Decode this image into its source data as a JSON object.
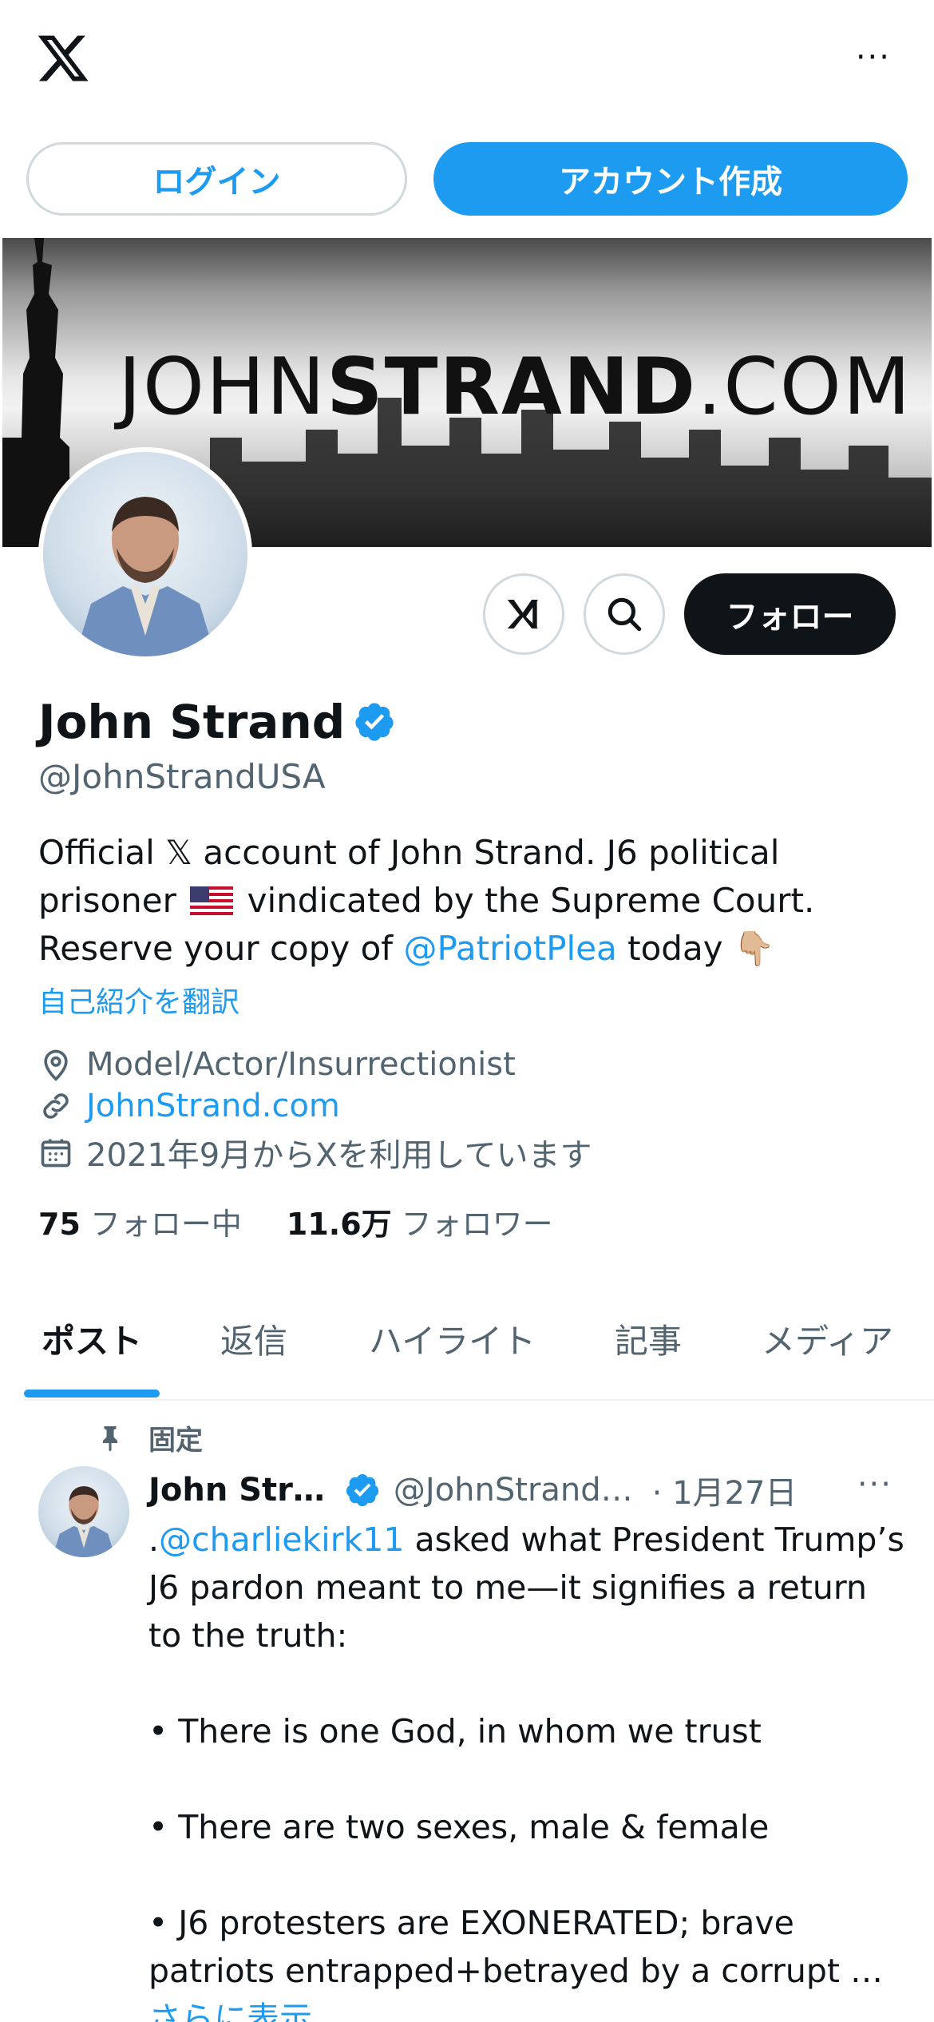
{
  "topbar": {
    "logo_icon": "x-logo-icon",
    "more_label": "···"
  },
  "auth": {
    "login_label": "ログイン",
    "signup_label": "アカウント作成"
  },
  "banner": {
    "text_light": "JOHN",
    "text_bold": "STRAND",
    "text_suffix": ".COM"
  },
  "profile": {
    "name": "John Strand",
    "handle": "@JohnStrandUSA",
    "follow_label": "フォロー",
    "bio": {
      "line1": "Official 𝕏 account of John Strand. J6 political",
      "line2_a": "prisoner ",
      "line2_b": " vindicated by the Supreme Court.",
      "line3_a": "Reserve your copy of ",
      "line3_link": "@PatriotPlea",
      "line3_b": " today ",
      "line3_emoji": "👇🏼"
    },
    "translate_label": "自己紹介を翻訳",
    "location": "Model/Actor/Insurrectionist",
    "website": "JohnStrand.com",
    "joined": "2021年9月からXを利用しています",
    "following_count": "75",
    "following_label": "フォロー中",
    "followers_count": "11.6万",
    "followers_label": "フォロワー"
  },
  "tabs": [
    {
      "label": "ポスト",
      "active": true
    },
    {
      "label": "返信"
    },
    {
      "label": "ハイライト"
    },
    {
      "label": "記事"
    },
    {
      "label": "メディア"
    }
  ],
  "post": {
    "pinned_label": "固定",
    "name": "John Str…",
    "handle": "@JohnStrand…",
    "date": "· 1月27日",
    "more_label": "···",
    "mention_prefix": ".",
    "mention": "@charliekirk11",
    "line1_rest": " asked what President Trump’s",
    "line2": "J6 pardon meant to me—it signifies a return",
    "line3": "to the truth:",
    "bullet1": "• There is one God, in whom we trust",
    "bullet2": "• There are two sexes, male & female",
    "bullet3_a": "• J6 protesters are EXONERATED; brave",
    "bullet3_b": "patriots entrapped+betrayed by a corrupt …",
    "show_more": "さらに表示"
  },
  "colors": {
    "accent": "#1d9bf0",
    "text": "#0f1419",
    "muted": "#536471",
    "border": "#cfd9de"
  }
}
